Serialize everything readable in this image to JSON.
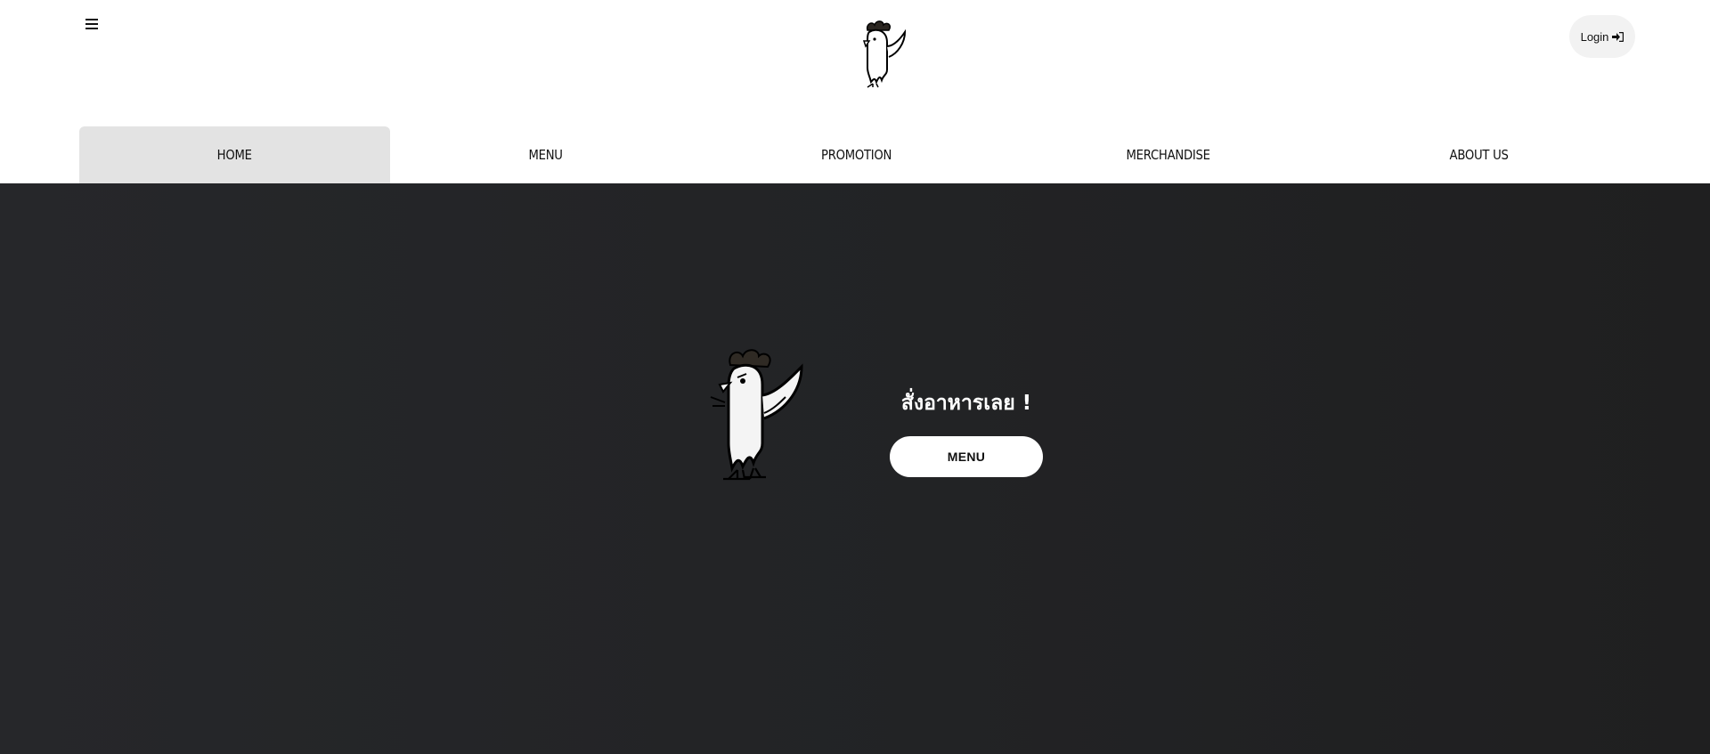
{
  "header": {
    "menu_icon": "hamburger-icon",
    "logo_icon": "chicken-logo-icon",
    "login_label": "Login",
    "login_icon": "sign-in-icon"
  },
  "nav": {
    "items": [
      {
        "label": "HOME",
        "active": true
      },
      {
        "label": "MENU",
        "active": false
      },
      {
        "label": "PROMOTION",
        "active": false
      },
      {
        "label": "MERCHANDISE",
        "active": false
      },
      {
        "label": "ABOUT US",
        "active": false
      }
    ]
  },
  "hero": {
    "mascot_icon": "chicken-mascot-icon",
    "title": "สั่งอาหารเลย !",
    "button_label": "MENU"
  },
  "colors": {
    "hero_background": "#242527",
    "nav_active_background": "#e3e3e3",
    "login_background": "#f2f2f2"
  }
}
